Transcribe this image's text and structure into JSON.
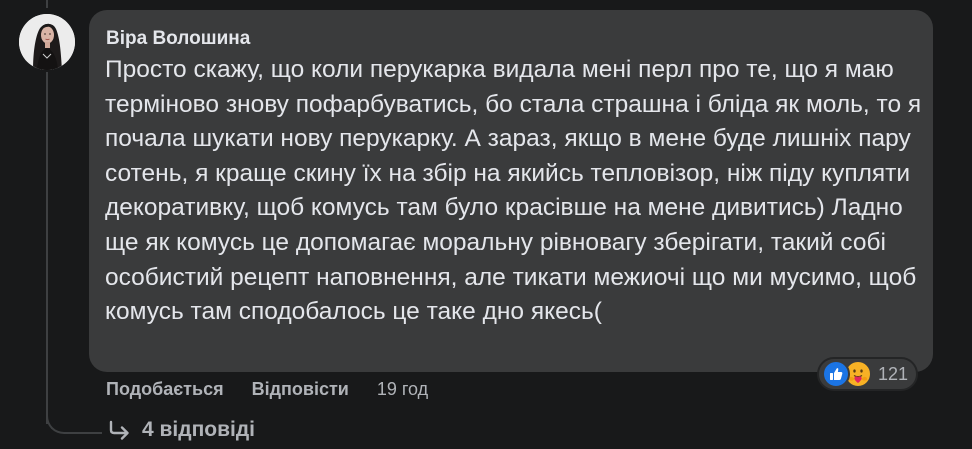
{
  "comment": {
    "author": "Віра Волошина",
    "text": "Просто скажу, що коли перукарка видала мені перл про те, що я маю терміново знову пофарбуватись, бо стала страшна і бліда як моль, то я почала шукати нову перукарку. А зараз, якщо в мене буде лишніх пару сотень, я краще скину їх на збір на якийсь тепловізор, ніж піду купляти декоративку, щоб комусь там було красівше на мене дивитись) Ладно ще як комусь це допомагає моральну рівновагу зберігати, такий собі особистий рецепт наповнення, але тикати межиочі що ми мусимо, щоб комусь там сподобалось це таке дно якесь("
  },
  "actions": {
    "like_label": "Подобається",
    "reply_label": "Відповісти",
    "timestamp": "19 год"
  },
  "reactions": {
    "icons": [
      "like-icon",
      "care-icon"
    ],
    "count": "121",
    "colors": {
      "like": "#1b74e4",
      "care": "#f7b125"
    }
  },
  "replies": {
    "label": "4 відповіді",
    "icon": "reply-arrow-icon"
  },
  "theme": {
    "background": "#18191a",
    "bubble": "#3a3b3c",
    "text_primary": "#e4e6eb",
    "text_secondary": "#b0b3b8"
  }
}
